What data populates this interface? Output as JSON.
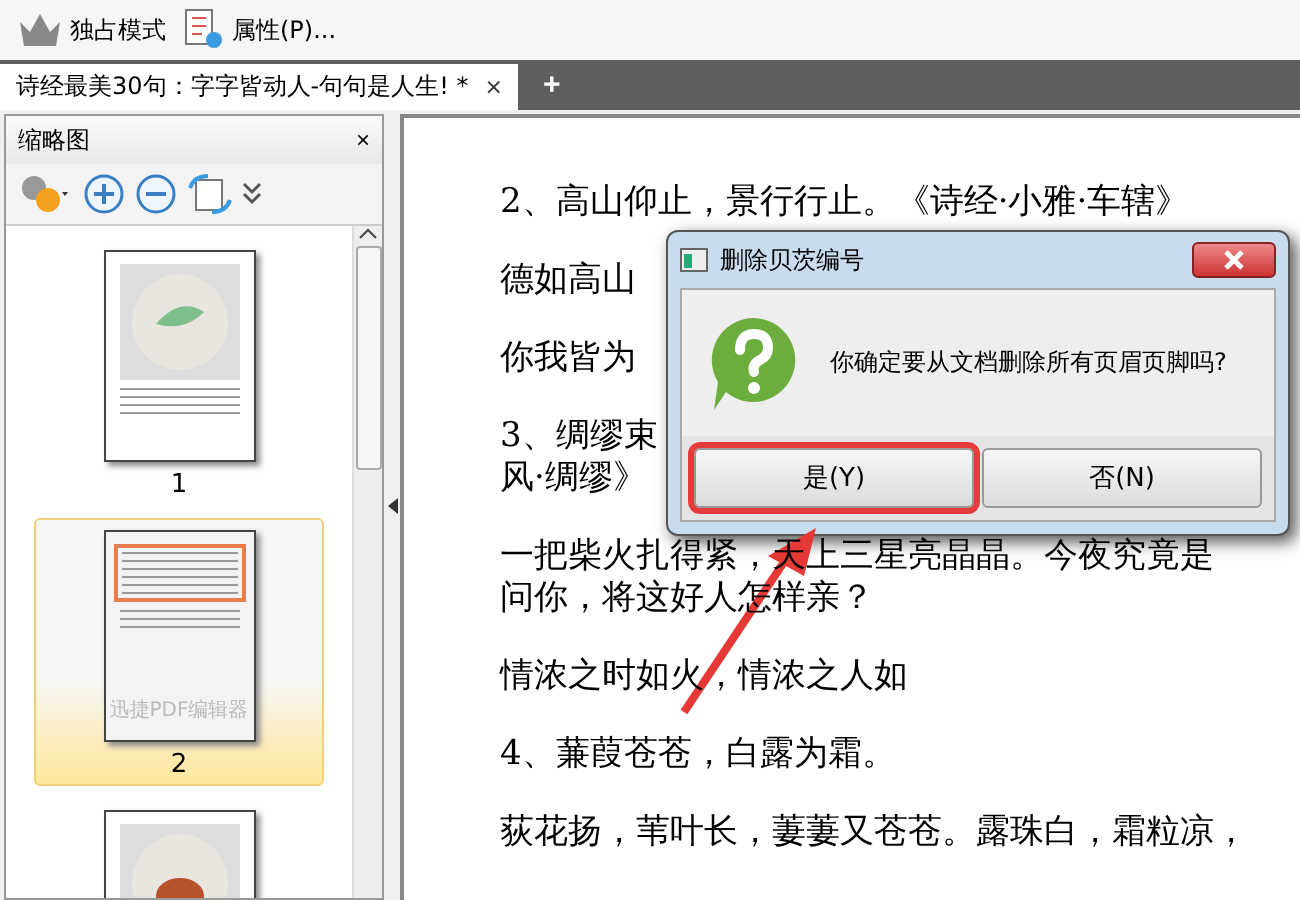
{
  "toolbar": {
    "items": [
      {
        "kind": "crown",
        "label": "独占模式"
      },
      {
        "kind": "properties",
        "label": "属性(P)..."
      }
    ]
  },
  "tabs": [
    {
      "label": "诗经最美30句：字字皆动人-句句是人生! *",
      "selected": true,
      "close": "×"
    }
  ],
  "new_tab": "+",
  "thumbnail_panel": {
    "title": "缩略图",
    "close": "×",
    "pages": [
      {
        "number": "1",
        "selected": false,
        "kind": "plant"
      },
      {
        "number": "2",
        "selected": true,
        "kind": "text",
        "watermark_text": "迅捷PDF编辑器"
      },
      {
        "selected": false,
        "kind": "fruit"
      }
    ]
  },
  "document": {
    "paragraphs": [
      {
        "lines": [
          "2、高山仰止，景行行止。《诗经·小雅·车辖》"
        ]
      },
      {
        "lines": [
          "德如高山"
        ]
      },
      {
        "lines": [
          "你我皆为"
        ]
      },
      {
        "lines": [
          "3、绸缪束",
          "风·绸缪》"
        ]
      },
      {
        "lines": [
          "一把柴火扎得紧，天上三星亮晶晶。今夜究竟是",
          "问你，将这好人怎样亲？"
        ]
      },
      {
        "lines": [
          "情浓之时如火，情浓之人如"
        ]
      },
      {
        "lines": [
          "4、蒹葭苍苍，白露为霜。"
        ]
      },
      {
        "lines": [
          "荻花扬，苇叶长，萋萋又苍苍。露珠白，霜粒凉，"
        ]
      }
    ]
  },
  "dialog": {
    "title": "删除贝茨编号",
    "message": "你确定要从文档删除所有页眉页脚吗?",
    "buttons": [
      {
        "label": "是(Y)",
        "selected": true
      },
      {
        "label": "否(N)",
        "selected": false
      }
    ]
  }
}
